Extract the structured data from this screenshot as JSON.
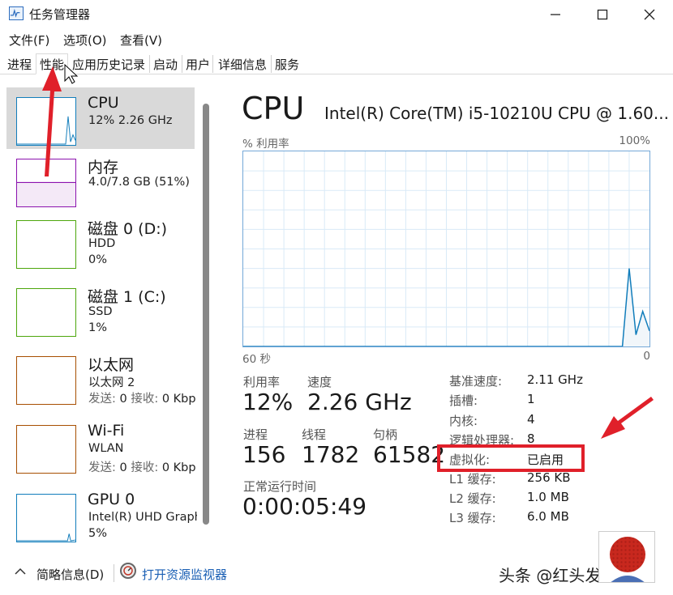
{
  "window": {
    "title": "任务管理器",
    "controls": [
      "minimize-icon",
      "maximize-icon",
      "close-icon"
    ]
  },
  "menu": {
    "file": "文件(F)",
    "options": "选项(O)",
    "view": "查看(V)"
  },
  "tabs": [
    {
      "label": "进程"
    },
    {
      "label": "性能",
      "active": true
    },
    {
      "label": "应用历史记录"
    },
    {
      "label": "启动"
    },
    {
      "label": "用户"
    },
    {
      "label": "详细信息"
    },
    {
      "label": "服务"
    }
  ],
  "sidebar": {
    "items": [
      {
        "title": "CPU",
        "line1": "12%  2.26 GHz",
        "color": "#117dbb",
        "selected": true,
        "spark": [
          0,
          0,
          0,
          0,
          0,
          0,
          0,
          0,
          0,
          0,
          0,
          0,
          0,
          0,
          0,
          0,
          0,
          0,
          0,
          0,
          0,
          60,
          5,
          20,
          8
        ]
      },
      {
        "title": "内存",
        "line1": "4.0/7.8 GB (51%)",
        "color": "#8b12ae",
        "fill_percent": 51
      },
      {
        "title": "磁盘 0 (D:)",
        "line1": "HDD",
        "line2": "0%",
        "color": "#4da60c"
      },
      {
        "title": "磁盘 1 (C:)",
        "line1": "SSD",
        "line2": "1%",
        "color": "#4da60c"
      },
      {
        "title": "以太网",
        "line1": "以太网 2",
        "line2_send_label": "发送: ",
        "line2_send": "0",
        "line2_recv_label": " 接收: ",
        "line2_recv": "0 Kbp",
        "color": "#a74f01"
      },
      {
        "title": "Wi-Fi",
        "line1": "WLAN",
        "line2_send_label": "发送: ",
        "line2_send": "0",
        "line2_recv_label": " 接收: ",
        "line2_recv": "0 Kbp",
        "color": "#a74f01"
      },
      {
        "title": "GPU 0",
        "line1": "Intel(R) UHD Graph",
        "line2": "5%",
        "color": "#117dbb"
      }
    ]
  },
  "main": {
    "title": "CPU",
    "model": "Intel(R) Core(TM) i5-10210U CPU @ 1.60...",
    "graph": {
      "label_left": "% 利用率",
      "label_right": "100%",
      "foot_left": "60 秒",
      "foot_right": "0",
      "color": "#117dbb",
      "utilization_series": [
        0,
        0,
        0,
        0,
        0,
        0,
        0,
        0,
        0,
        0,
        0,
        0,
        0,
        0,
        0,
        0,
        0,
        0,
        0,
        0,
        0,
        0,
        0,
        0,
        0,
        0,
        0,
        0,
        0,
        0,
        0,
        0,
        0,
        0,
        0,
        0,
        0,
        0,
        0,
        0,
        0,
        0,
        0,
        0,
        0,
        0,
        0,
        0,
        0,
        0,
        0,
        0,
        0,
        0,
        0,
        0,
        0,
        40,
        6,
        18,
        8
      ]
    },
    "stats": {
      "utilization_label": "利用率",
      "utilization": "12%",
      "speed_label": "速度",
      "speed": "2.26 GHz",
      "processes_label": "进程",
      "processes": "156",
      "threads_label": "线程",
      "threads": "1782",
      "handles_label": "句柄",
      "handles": "61582",
      "uptime_label": "正常运行时间",
      "uptime": "0:00:05:49"
    },
    "details": [
      {
        "k": "基准速度:",
        "v": "2.11 GHz"
      },
      {
        "k": "插槽:",
        "v": "1"
      },
      {
        "k": "内核:",
        "v": "4"
      },
      {
        "k": "逻辑处理器:",
        "v": "8"
      },
      {
        "k": "虚拟化:",
        "v": "已启用"
      },
      {
        "k": "L1 缓存:",
        "v": "256 KB"
      },
      {
        "k": "L2 缓存:",
        "v": "1.0 MB"
      },
      {
        "k": "L3 缓存:",
        "v": "6.0 MB"
      }
    ]
  },
  "bottom": {
    "fewer_details": "简略信息(D)",
    "open_monitor": "打开资源监视器",
    "watermark": "头条 @红头发蓝胖子"
  },
  "colors": {
    "annotation_red": "#e0202a",
    "selected_bg": "#d9d9d9",
    "link": "#1a5fb4"
  }
}
